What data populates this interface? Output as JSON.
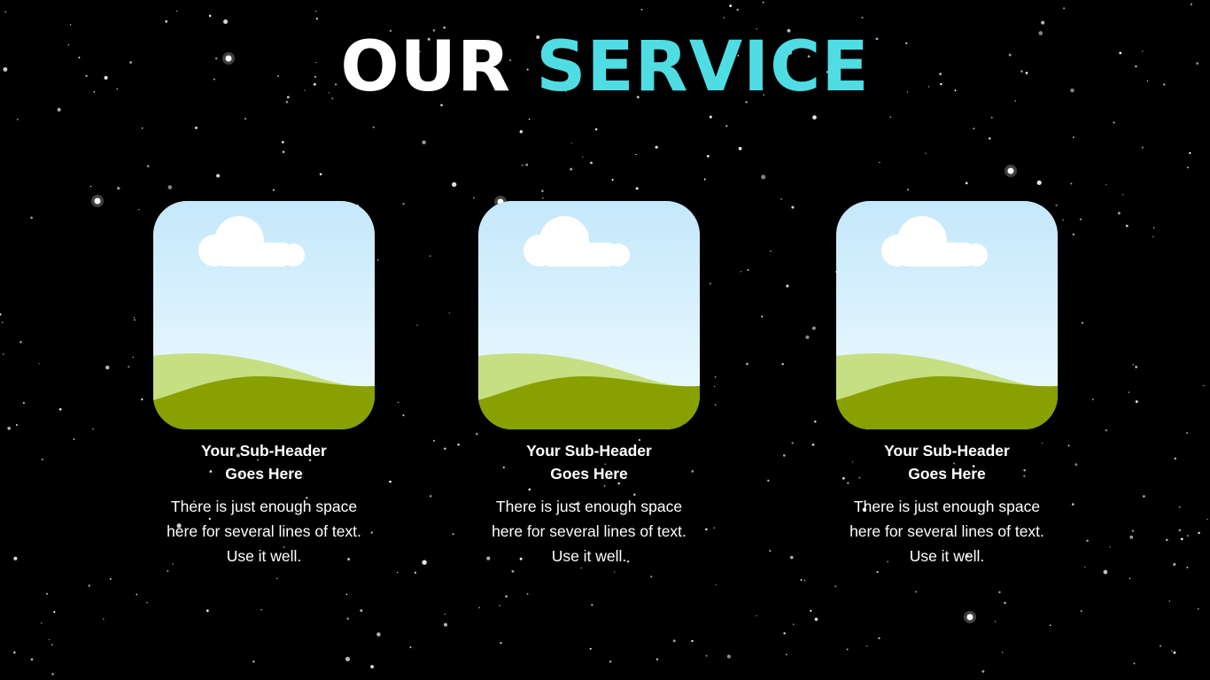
{
  "title": {
    "part1": "OUR",
    "part2": "SERVICE"
  },
  "colors": {
    "background": "#000000",
    "accent": "#4fdde3",
    "sky_top": "#c4e8fb",
    "sky_bottom": "#f1fbff",
    "hill_light": "#c5df82",
    "hill_dark": "#88a000",
    "cloud": "#ffffff"
  },
  "cards": [
    {
      "icon": "landscape-image-placeholder",
      "subheader": [
        "Your Sub-Header",
        "Goes Here"
      ],
      "text": [
        "There is just enough space",
        "here for several lines of text.",
        "Use it well."
      ]
    },
    {
      "icon": "landscape-image-placeholder",
      "subheader": [
        "Your Sub-Header",
        "Goes Here"
      ],
      "text": [
        "There is just enough space",
        "here for several lines of text.",
        "Use it well."
      ]
    },
    {
      "icon": "landscape-image-placeholder",
      "subheader": [
        "Your Sub-Header",
        "Goes Here"
      ],
      "text": [
        "There is just enough space",
        "here for several lines of text.",
        "Use it well."
      ]
    }
  ]
}
